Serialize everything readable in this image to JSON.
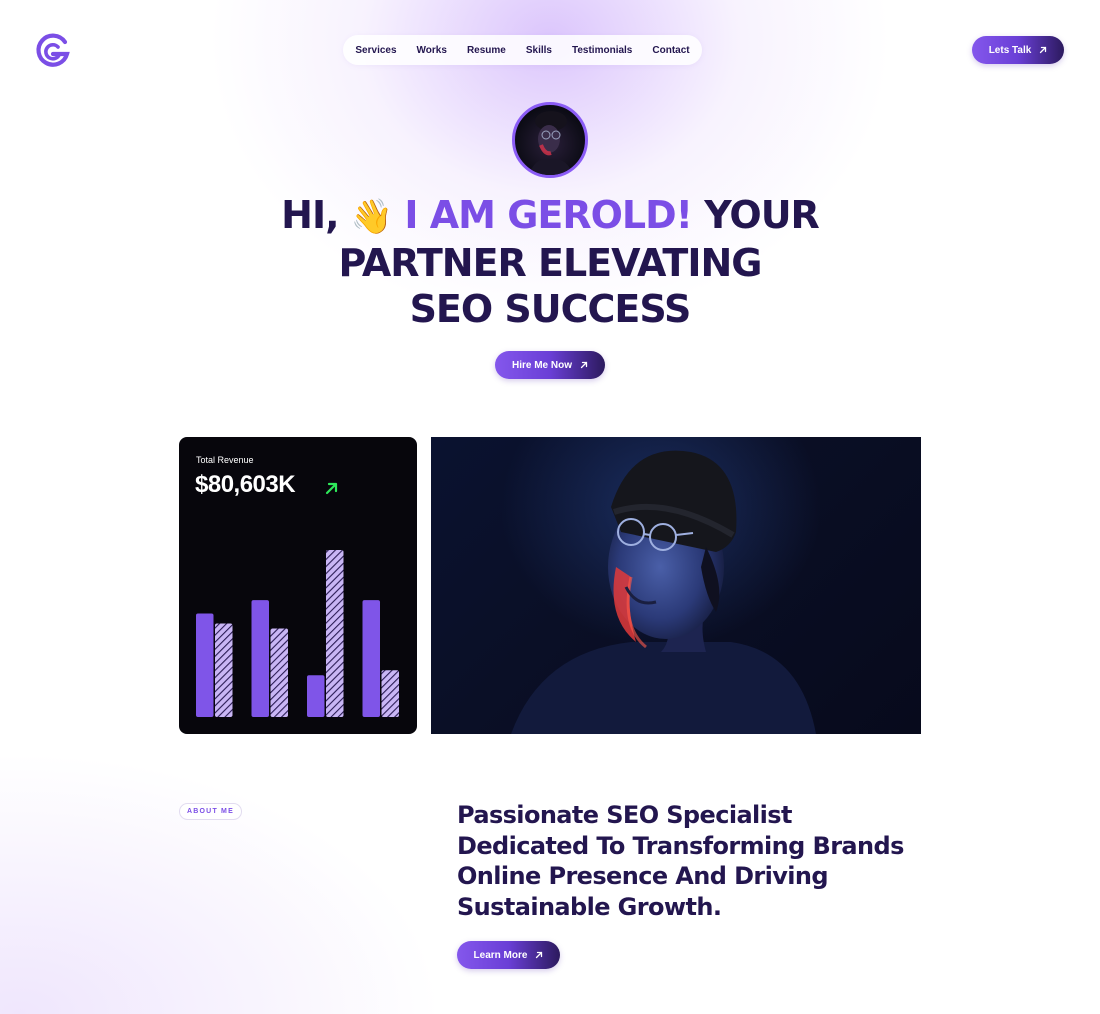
{
  "brand": {
    "logo_icon": "g-logo-icon",
    "accent": "#7b4ee6",
    "dark": "#23164f"
  },
  "nav": {
    "items": [
      "Services",
      "Works",
      "Resume",
      "Skills",
      "Testimonials",
      "Contact"
    ]
  },
  "header": {
    "cta_label": "Lets Talk"
  },
  "hero": {
    "greeting": "HI,",
    "wave_emoji": "👋",
    "name_part": "I AM GEROLD!",
    "rest_line1": "YOUR",
    "line2": "PARTNER ELEVATING",
    "line3": "SEO SUCCESS",
    "cta_label": "Hire Me Now"
  },
  "revenue": {
    "label": "Total Revenue",
    "value": "$80,603K",
    "trend_icon": "arrow-up-right-icon",
    "trend_color": "#2ee85a"
  },
  "chart_data": {
    "type": "bar",
    "categories": [
      "1",
      "2",
      "3",
      "4"
    ],
    "series": [
      {
        "values": [
          62,
          70,
          25,
          70
        ]
      },
      {
        "values": [
          56,
          53,
          100,
          28
        ]
      }
    ],
    "ylim": [
      0,
      100
    ],
    "colors": [
      "#7f55e8",
      "#c9b6f5"
    ]
  },
  "about": {
    "pill": "ABOUT ME",
    "headline": "Passionate SEO Specialist Dedicated To Transforming Brands Online Presence And Driving Sustainable Growth.",
    "cta_label": "Learn More"
  }
}
